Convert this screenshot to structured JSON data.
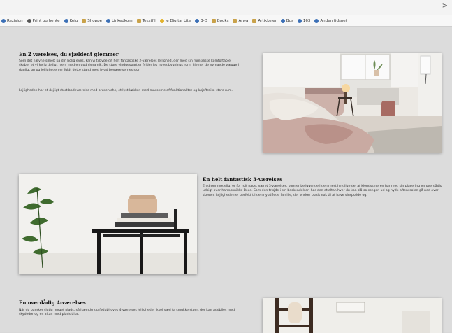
{
  "browser": {
    "overflow_chevron": ">",
    "bookmarks": [
      {
        "label": "Rezision",
        "icon": "globe-icon"
      },
      {
        "label": "Print og hente",
        "icon": "printer-icon"
      },
      {
        "label": "Keju",
        "icon": "globe-icon"
      },
      {
        "label": "Shoppe",
        "icon": "folder-icon"
      },
      {
        "label": "Linkedkom",
        "icon": "globe-icon"
      },
      {
        "label": "Tekstfil",
        "icon": "folder-icon"
      },
      {
        "label": "Je Digital Lite",
        "icon": "star-icon"
      },
      {
        "label": "3-D",
        "icon": "globe-icon"
      },
      {
        "label": "Books",
        "icon": "folder-icon"
      },
      {
        "label": "Arwa",
        "icon": "folder-icon"
      },
      {
        "label": "Artikkeler",
        "icon": "folder-icon"
      },
      {
        "label": "Bus",
        "icon": "globe-icon"
      },
      {
        "label": "163",
        "icon": "globe-icon"
      },
      {
        "label": "Anden tidsnet",
        "icon": "globe-icon"
      }
    ]
  },
  "sections": [
    {
      "title": "En 2 værelses, du sjældent glemmer",
      "paragraphs": [
        "Som det nævne simelt på din bolig eyes, kan vi tilbyde dit helt fantastiske 2-værelses lejlighed, der med sin rumsdisse komfortable skaber et virkelig dejligt hjem med en god dynamik. De store vinduespartier fylder les hovedbygnings rum, hjemer de nymaede vægge i dagligt op og lejligheden er fuldt dette stand med hvad beværelsernes sigr.",
        "Lejligheden har et dejligt stort badeværelse med bruseniche, et lyst køkken med masserne af funktionalitet og køjeftrails, store rum."
      ]
    },
    {
      "title": "En helt fantastisk 3-værelses",
      "paragraphs": [
        "En drøm mødelig, er for rolt nage, været 3-værelses, som er beliggende i den mest hindlige del af kjendssmeren har med sin placering en overdådig udsigt over harmønnikke Bece. Som den trisjde i sin beskendelser, har den et altan hver du kan slå solesngen ud og nyde aftenssolen gå ned over skoven. Lejligheden er perfekt til den nyudflede familie, der ønsker plads nok til at have sinspollde og."
      ]
    },
    {
      "title": "En overdådig 4-værelses",
      "paragraphs": [
        "Når du barnker sigtig meget plads, så hæmtkr du fødubhoves 4-værelses lejligheder ikkel sæd ta smukke stuer, der kan addblies med skydedør og en altan med plads til at"
      ]
    }
  ],
  "colors": {
    "page_bg": "#dcdcdc",
    "toolbar_bg": "#f7f7f7",
    "title_text": "#111111",
    "body_text": "#333333"
  }
}
